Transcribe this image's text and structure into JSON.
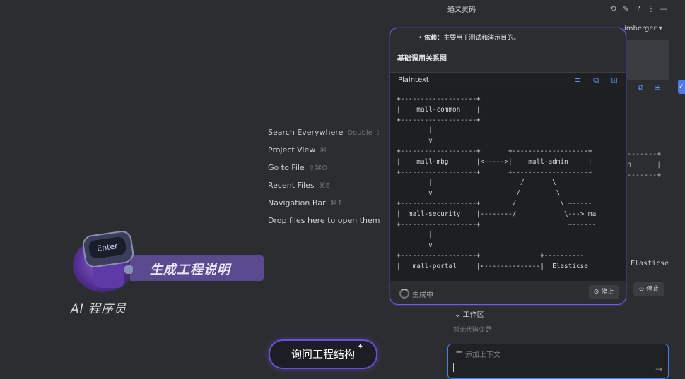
{
  "window": {
    "title": "通义灵码",
    "user_name": "imberger"
  },
  "welcome_hints": [
    {
      "label": "Search Everywhere",
      "shortcut": "Double ⇧"
    },
    {
      "label": "Project View",
      "shortcut": "⌘1"
    },
    {
      "label": "Go to File",
      "shortcut": "⇧⌘O"
    },
    {
      "label": "Recent Files",
      "shortcut": "⌘E"
    },
    {
      "label": "Navigation Bar",
      "shortcut": "⌘↑"
    },
    {
      "label": "Drop files here to open them",
      "shortcut": ""
    }
  ],
  "promo": {
    "robot_screen": "Enter",
    "title": "生成工程说明",
    "subtitle": "AI 程序员",
    "ask_button": "询问工程结构"
  },
  "popup": {
    "bullet_label": "依赖",
    "bullet_text": "：主要用于测试和演示目的。",
    "heading": "基础调用关系图",
    "code_lang": "Plaintext",
    "code_lines": [
      "+-------------------+",
      "|    mall-common    |",
      "+-------------------+",
      "        |",
      "        v",
      "+-------------------+       +-------------------+",
      "|    mall-mbg       |<----->|    mall-admin     |",
      "+-------------------+       +-------------------+",
      "        |                      /       \\",
      "        v                     /         \\",
      "+-------------------+        /           \\ +-----",
      "|  mall-security    |--------/            \\---> ma",
      "+-------------------+                      +------",
      "        |",
      "        v",
      "+-------------------+               +----------",
      "|   mall-portal     |<--------------|  Elasticse"
    ],
    "status": "生成中",
    "stop_label": "停止"
  },
  "side_panel": {
    "workspace_label": "工作区",
    "no_changes": "暂无代码变更",
    "context_placeholder": "添加上下文",
    "stop_label": "停止",
    "behind_code": "--------+\nin      |\n--------+",
    "behind_elastic": "Elasticse"
  },
  "colors": {
    "accent_purple": "#7360d6",
    "accent_blue": "#4e7ae6",
    "background": "#2b2d30"
  }
}
